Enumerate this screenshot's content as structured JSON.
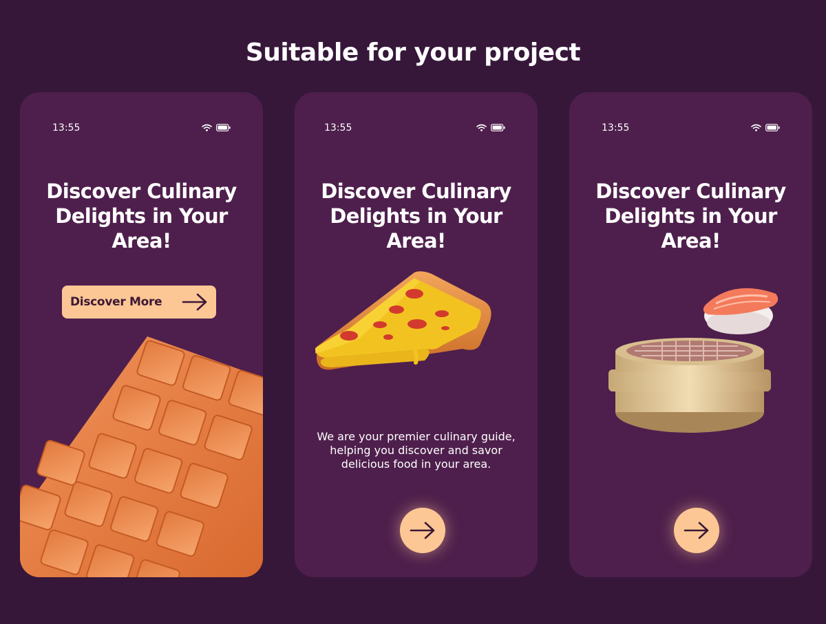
{
  "page": {
    "title": "Suitable for your project"
  },
  "screens": [
    {
      "time": "13:55",
      "headline": "Discover Culinary Delights in Your Area!",
      "button_label": "Discover More",
      "illustration": "chocolate-bar"
    },
    {
      "time": "13:55",
      "headline": "Discover Culinary Delights in Your Area!",
      "body": "We are your premier culinary guide, helping you discover and savor delicious food in your area.",
      "illustration": "pizza-slice"
    },
    {
      "time": "13:55",
      "headline": "Discover Culinary Delights in Your Area!",
      "illustration": "sushi-and-steamer"
    }
  ],
  "icons": [
    "wifi-icon",
    "battery-icon",
    "arrow-right-icon"
  ],
  "colors": {
    "background": "#36173a",
    "phone": "#4e1f4c",
    "accent": "#fcc795",
    "accent_text": "#3d1836",
    "text": "#ffffff"
  }
}
